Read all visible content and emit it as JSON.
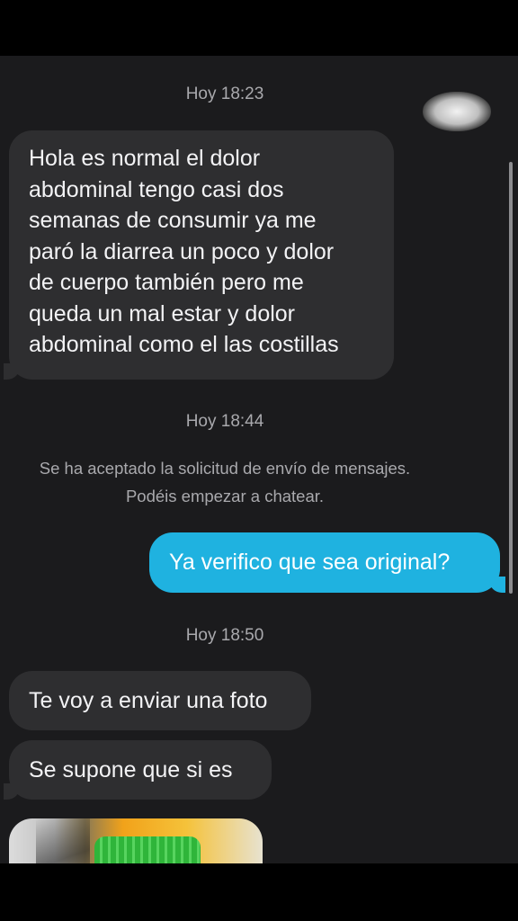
{
  "messages": {
    "timestamp_1": "Hoy 18:23",
    "incoming_1": {
      "lines": [
        "Hola es normal el dolor",
        "abdominal tengo casi dos",
        "semanas de consumir ya me",
        "paró la diarrea un poco y dolor",
        "de cuerpo también pero me",
        "queda un mal estar y dolor",
        "abdominal como el las costillas"
      ]
    },
    "timestamp_2": "Hoy 18:44",
    "system_notice": {
      "line_1": "Se ha aceptado la solicitud de envío de mensajes.",
      "line_2": "Podéis empezar a chatear."
    },
    "outgoing_1": "Ya verifico que sea original?",
    "timestamp_3": "Hoy 18:50",
    "incoming_2": "Te voy a enviar una foto",
    "incoming_3": "Se supone que si es"
  },
  "colors": {
    "background": "#000000",
    "chat_background": "#1b1b1d",
    "incoming_bubble": "#2e2e30",
    "outgoing_bubble": "#1fb2e0",
    "timestamp_text": "#a9a9ad"
  }
}
